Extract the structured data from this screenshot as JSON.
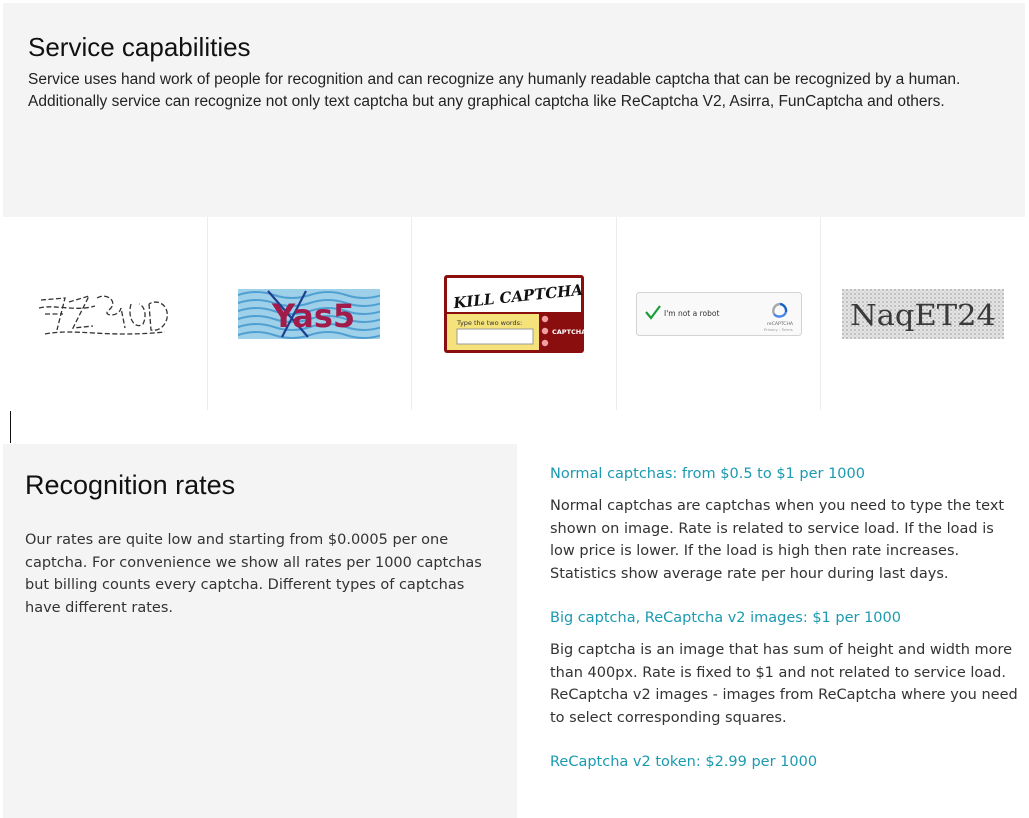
{
  "capabilities": {
    "title": "Service capabilities",
    "description": "Service uses hand work of people for recognition and can recognize any humanly readable captcha that can be recognized by a human. Additionally service can recognize not only text captcha but any graphical captcha like ReCaptcha V2, Asirra, FunCaptcha and others."
  },
  "captchas": {
    "yas5_text": "Yas5",
    "solve_media_words": "KILL CAPTCHA",
    "solve_media_prompt": "Type the two words:",
    "solve_media_brand": "CAPTCHA",
    "recaptcha_label": "I'm not a robot",
    "recaptcha_brand": "reCAPTCHA",
    "recaptcha_links": "Privacy - Terms",
    "noisy_text": "NaqET24"
  },
  "rates": {
    "title": "Recognition rates",
    "intro": "Our rates are quite low and starting from $0.0005 per one captcha. For convenience we show all rates per 1000 captchas but billing counts every captcha. Different types of captchas have different rates.",
    "items": [
      {
        "title": "Normal captchas: from $0.5 to $1 per 1000",
        "description": "Normal captchas are captchas when you need to type the text shown on image. Rate is related to service load. If the load is low price is lower. If the load is high then rate increases. Statistics show average rate per hour during last days."
      },
      {
        "title": "Big captcha, ReCaptcha v2 images: $1 per 1000",
        "description": "Big captcha is an image that has sum of height and width more than 400px. Rate is fixed to $1 and not related to service load. ReCaptcha v2 images - images from ReCaptcha where you need to select corresponding squares."
      },
      {
        "title": "ReCaptcha v2 token: $2.99 per 1000"
      }
    ]
  },
  "colors": {
    "accent": "#1b9ab0",
    "panel": "#f4f4f4",
    "solve_media_red": "#8b0e0e",
    "solve_media_yellow": "#f5e27a"
  }
}
